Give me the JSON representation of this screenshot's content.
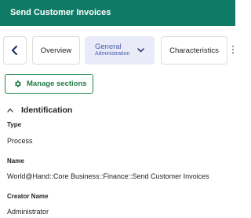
{
  "header": {
    "title": "Send Customer Invoices"
  },
  "tabs": {
    "overview": "Overview",
    "general": {
      "label": "General",
      "sublabel": "Administration"
    },
    "characteristics": "Characteristics"
  },
  "manage_sections": {
    "label": "Manage sections"
  },
  "section": {
    "title": "Identification",
    "fields": [
      {
        "label": "Type",
        "value": "Process"
      },
      {
        "label": "Name",
        "value": "World@Hand::Core Business::Finance::Send Customer Invoices"
      },
      {
        "label": "Creator Name",
        "value": "Administrator"
      }
    ]
  },
  "colors": {
    "header_bg": "#0f7a66",
    "active_tab_bg": "#e9ecf8",
    "accent_green": "#1e8a4d"
  },
  "icons": [
    "chevron-left-icon",
    "chevron-down-icon",
    "more-vertical-icon",
    "gear-icon",
    "chevron-up-icon"
  ]
}
